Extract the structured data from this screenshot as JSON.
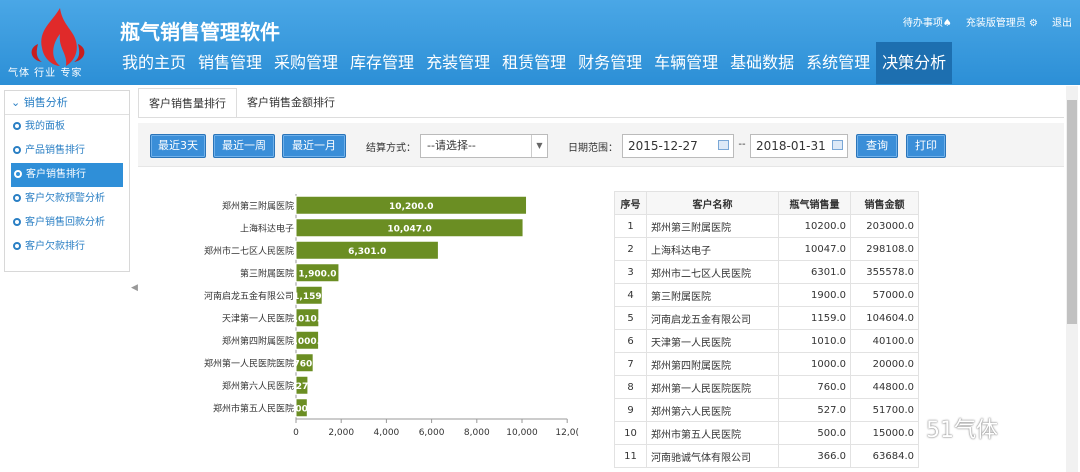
{
  "app": {
    "title": "瓶气销售管理软件",
    "logo_tagline": "气体 行业 专家"
  },
  "top_links": {
    "todo": "待办事项",
    "user": "充装版管理员",
    "logout": "退出"
  },
  "nav": [
    "我的主页",
    "销售管理",
    "采购管理",
    "库存管理",
    "充装管理",
    "租赁管理",
    "财务管理",
    "车辆管理",
    "基础数据",
    "系统管理",
    "决策分析"
  ],
  "sidebar": {
    "section": "销售分析",
    "items": [
      "我的面板",
      "产品销售排行",
      "客户销售排行",
      "客户欠款预警分析",
      "客户销售回款分析",
      "客户欠款排行"
    ]
  },
  "tabs": [
    "客户销售量排行",
    "客户销售金额排行"
  ],
  "toolbar": {
    "btn_3days": "最近3天",
    "btn_week": "最近一周",
    "btn_month": "最近一月",
    "settle_label": "结算方式：",
    "settle_value": "--请选择--",
    "date_label": "日期范围：",
    "date_from": "2015-12-27",
    "date_sep": "--",
    "date_to": "2018-01-31",
    "query": "查询",
    "print": "打印"
  },
  "chart_data": {
    "type": "bar",
    "orientation": "horizontal",
    "categories": [
      "郑州第三附属医院",
      "上海科达电子",
      "郑州市二七区人民医院",
      "第三附属医院",
      "河南启龙五金有限公司",
      "天津第一人民医院",
      "郑州第四附属医院",
      "郑州第一人民医院医院",
      "郑州第六人民医院",
      "郑州市第五人民医院"
    ],
    "values": [
      10200.0,
      10047.0,
      6301.0,
      1900.0,
      1159.0,
      1010.0,
      1000.0,
      760.0,
      527.0,
      500.0
    ],
    "value_labels": [
      "10,200.0",
      "10,047.0",
      "6,301.0",
      "1,900.0",
      "1,159.",
      ",010.",
      ",000.",
      "760.",
      "27",
      "00"
    ],
    "x_ticks": [
      "0",
      "2,000",
      "4,000",
      "6,000",
      "8,000",
      "10,000",
      "12,0("
    ],
    "xlim": [
      0,
      12000
    ],
    "bar_color": "#6b8e23"
  },
  "table": {
    "headers": [
      "序号",
      "客户名称",
      "瓶气销售量",
      "销售金额"
    ],
    "rows": [
      [
        "1",
        "郑州第三附属医院",
        "10200.0",
        "203000.0"
      ],
      [
        "2",
        "上海科达电子",
        "10047.0",
        "298108.0"
      ],
      [
        "3",
        "郑州市二七区人民医院",
        "6301.0",
        "355578.0"
      ],
      [
        "4",
        "第三附属医院",
        "1900.0",
        "57000.0"
      ],
      [
        "5",
        "河南启龙五金有限公司",
        "1159.0",
        "104604.0"
      ],
      [
        "6",
        "天津第一人民医院",
        "1010.0",
        "40100.0"
      ],
      [
        "7",
        "郑州第四附属医院",
        "1000.0",
        "20000.0"
      ],
      [
        "8",
        "郑州第一人民医院医院",
        "760.0",
        "44800.0"
      ],
      [
        "9",
        "郑州第六人民医院",
        "527.0",
        "51700.0"
      ],
      [
        "10",
        "郑州市第五人民医院",
        "500.0",
        "15000.0"
      ],
      [
        "11",
        "河南驰诚气体有限公司",
        "366.0",
        "63684.0"
      ]
    ]
  },
  "watermark": "51气体"
}
